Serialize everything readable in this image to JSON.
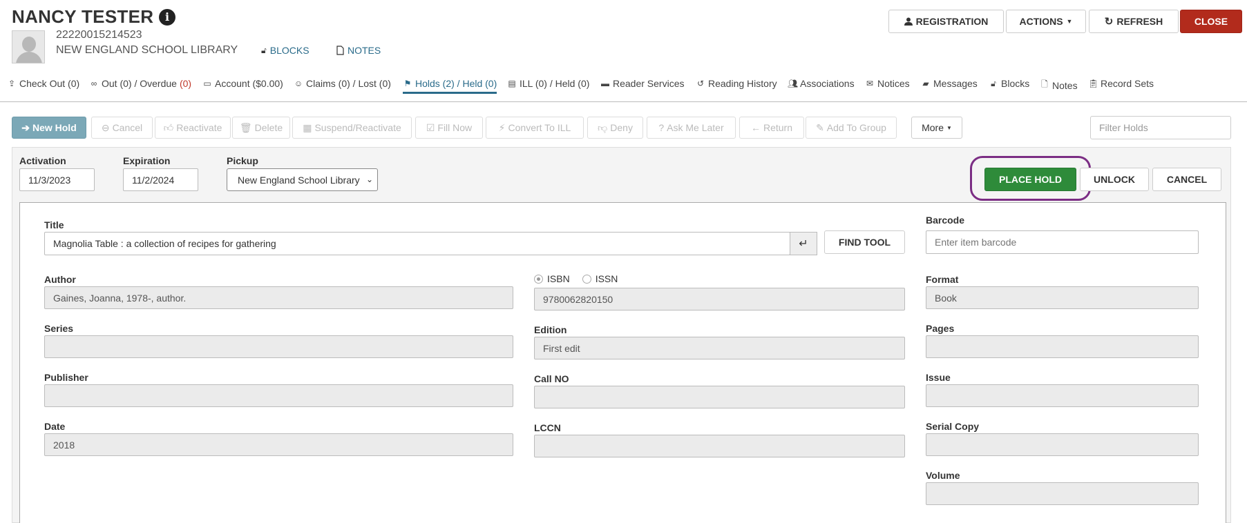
{
  "patron": {
    "name": "NANCY TESTER",
    "barcode": "22220015214523",
    "library": "NEW ENGLAND SCHOOL LIBRARY",
    "blocks_link": "BLOCKS",
    "notes_link": "NOTES"
  },
  "header_buttons": {
    "registration": "REGISTRATION",
    "actions": "ACTIONS",
    "refresh": "REFRESH",
    "close": "CLOSE"
  },
  "tabs": [
    {
      "label": "Check Out (0)",
      "icon": "upload-icon"
    },
    {
      "label": "Out (0) / Overdue ",
      "red": "(0)",
      "icon": "binoculars-icon"
    },
    {
      "label": "Account ($0.00)",
      "icon": "money-icon"
    },
    {
      "label": "Claims (0) / Lost (0)",
      "icon": "smile-icon"
    },
    {
      "label": "Holds (2) / Held (0)",
      "icon": "flag-icon",
      "active": true
    },
    {
      "label": "ILL (0) / Held (0)",
      "icon": "book-icon"
    },
    {
      "label": "Reader Services",
      "icon": "card-icon"
    },
    {
      "label": "Reading History",
      "icon": "history-icon"
    },
    {
      "label": "Associations",
      "icon": "users-icon"
    },
    {
      "label": "Notices",
      "icon": "envelope-icon"
    },
    {
      "label": "Messages",
      "icon": "comment-icon"
    },
    {
      "label": "Blocks",
      "icon": "unlock-icon"
    },
    {
      "label": "Notes",
      "icon": "file-icon"
    },
    {
      "label": "Record Sets",
      "icon": "clipboard-icon"
    }
  ],
  "toolbar": {
    "new_hold": "New Hold",
    "cancel": "Cancel",
    "reactivate": "Reactivate",
    "delete": "Delete",
    "suspend": "Suspend/Reactivate",
    "fill_now": "Fill Now",
    "convert_ill": "Convert To ILL",
    "deny": "Deny",
    "ask_later": "Ask Me Later",
    "return": "Return",
    "add_group": "Add To Group",
    "more": "More",
    "filter_placeholder": "Filter Holds"
  },
  "hold_form": {
    "activation_label": "Activation",
    "activation_value": "11/3/2023",
    "expiration_label": "Expiration",
    "expiration_value": "11/2/2024",
    "pickup_label": "Pickup",
    "pickup_value": "New England School Library",
    "place_hold": "PLACE HOLD",
    "unlock": "UNLOCK",
    "cancel": "CANCEL"
  },
  "item": {
    "title_label": "Title",
    "title_value": "Magnolia Table : a collection of recipes for gathering",
    "find_tool": "FIND TOOL",
    "barcode_label": "Barcode",
    "barcode_placeholder": "Enter item barcode",
    "author_label": "Author",
    "author_value": "Gaines, Joanna, 1978-, author.",
    "isbn_label": "ISBN",
    "issn_label": "ISSN",
    "isbn_value": "9780062820150",
    "format_label": "Format",
    "format_value": "Book",
    "series_label": "Series",
    "series_value": "",
    "edition_label": "Edition",
    "edition_value": "First edit",
    "pages_label": "Pages",
    "pages_value": "",
    "publisher_label": "Publisher",
    "publisher_value": "",
    "callno_label": "Call NO",
    "callno_value": "",
    "issue_label": "Issue",
    "issue_value": "",
    "date_label": "Date",
    "date_value": "2018",
    "lccn_label": "LCCN",
    "lccn_value": "",
    "serial_copy_label": "Serial Copy",
    "serial_copy_value": "",
    "volume_label": "Volume",
    "volume_value": ""
  },
  "colors": {
    "close": "#b22b1c",
    "place_hold": "#2e8b3a",
    "highlight_ring": "#7b2d84",
    "active_tab": "#2a6b8a",
    "new_hold": "#7ba8b7"
  }
}
